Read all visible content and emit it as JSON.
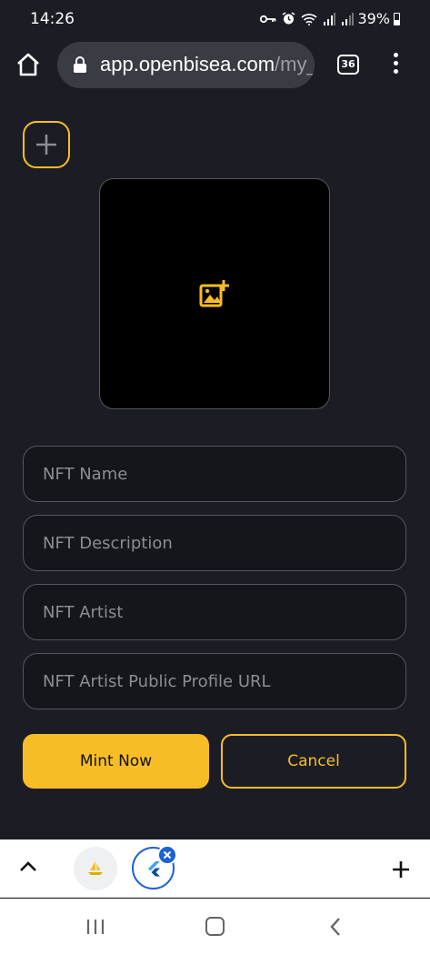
{
  "status_bar": {
    "time": "14:26",
    "battery": "39%",
    "icons": [
      "key-icon",
      "alarm-icon",
      "wifi-icon",
      "signal-icon",
      "signal-icon",
      "battery-icon"
    ]
  },
  "browser": {
    "url_main": "app.openbisea.com",
    "url_rest": "/my_",
    "tab_count": "36"
  },
  "form": {
    "add_icon": "plus-icon",
    "upload_icon": "add-photo-icon",
    "fields": [
      {
        "placeholder": "NFT Name",
        "value": ""
      },
      {
        "placeholder": "NFT Description",
        "value": ""
      },
      {
        "placeholder": "NFT Artist",
        "value": ""
      },
      {
        "placeholder": "NFT Artist Public Profile URL",
        "value": ""
      }
    ],
    "mint_label": "Mint Now",
    "cancel_label": "Cancel"
  },
  "colors": {
    "background": "#1c1d24",
    "accent": "#f7bd27",
    "field_bg": "#15161c",
    "field_border": "#55575e"
  }
}
